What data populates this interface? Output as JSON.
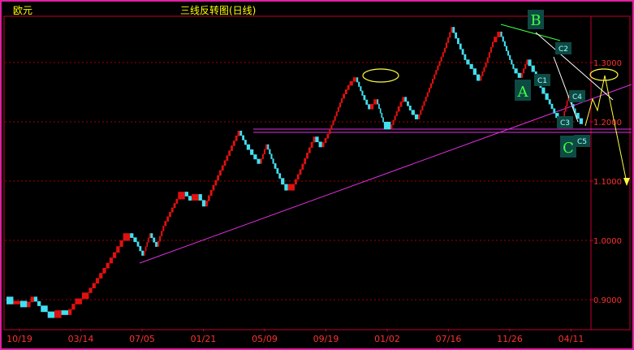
{
  "header": {
    "instrument": "欧元",
    "chart_title": "三线反转图(日线)"
  },
  "colors": {
    "up": "#e01010",
    "down": "#40e0f0",
    "frame": "#c00030",
    "grid": "#a00000",
    "axis_text": "#ff3030",
    "trend": "#e030e0",
    "label_box": "#0d4a44",
    "label_green": "#40ff40",
    "label_cyan": "#a0ffff",
    "highlight": "#ffff40",
    "outline": "#ffffff",
    "wedge_top": "#40ff40"
  },
  "chart_data": {
    "type": "line",
    "xlabel": "",
    "ylabel": "",
    "ylim": [
      0.84,
      1.385
    ],
    "y_ticks": [
      "0.9000",
      "1.0000",
      "1.1000",
      "1.2000",
      "1.3000"
    ],
    "y_tick_values": [
      0.9,
      1.0,
      1.1,
      1.2,
      1.3
    ],
    "x_ticks": [
      "10/19",
      "03/14",
      "07/05",
      "01/21",
      "05/09",
      "09/19",
      "01/02",
      "07/16",
      "11/26",
      "04/11"
    ],
    "grid": true,
    "series": [
      {
        "values": [
          0.905,
          0.893,
          0.898,
          0.888,
          0.905,
          0.89,
          0.88,
          0.87,
          0.882,
          0.875,
          0.893,
          0.902,
          0.912,
          0.928,
          0.945,
          0.962,
          0.98,
          1.0,
          1.012,
          0.998,
          0.975,
          1.012,
          0.99,
          1.025,
          1.048,
          1.07,
          1.082,
          1.068,
          1.078,
          1.058,
          1.085,
          1.11,
          1.135,
          1.16,
          1.185,
          1.162,
          1.145,
          1.13,
          1.162,
          1.13,
          1.105,
          1.085,
          1.095,
          1.12,
          1.148,
          1.175,
          1.158,
          1.18,
          1.21,
          1.24,
          1.262,
          1.275,
          1.245,
          1.222,
          1.238,
          1.2,
          1.188,
          1.218,
          1.242,
          1.22,
          1.205,
          1.235,
          1.265,
          1.295,
          1.325,
          1.36,
          1.332,
          1.305,
          1.29,
          1.27,
          1.3,
          1.335,
          1.352,
          1.32,
          1.29,
          1.275,
          1.305,
          1.285,
          1.258,
          1.238,
          1.215,
          1.2,
          1.245,
          1.215,
          1.197
        ]
      }
    ],
    "annotations": {
      "waves": [
        "A",
        "B",
        "C"
      ],
      "points": [
        "C1",
        "C2",
        "C3",
        "C4",
        "C5"
      ]
    }
  }
}
